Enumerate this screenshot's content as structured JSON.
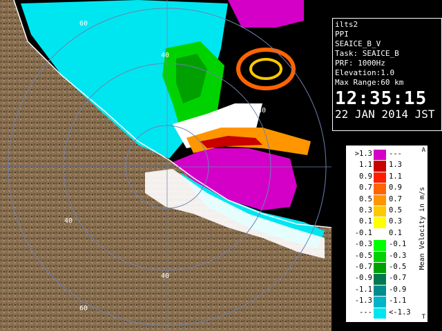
{
  "info": {
    "radar": "ilts2",
    "product": "PPI",
    "field": "SEAICE_B_V",
    "task": "Task: SEAICE_B",
    "prf": "PRF: 1000Hz",
    "elevation": "Elevation:1.0",
    "max_range": "Max Range:60 km",
    "time": "12:35:15",
    "date": "22 JAN 2014 JST"
  },
  "legend": {
    "title": "Mean Velocity in m/s",
    "corner_top": "A",
    "corner_bottom": "T",
    "rows": [
      {
        "left": ">1.3",
        "right": "---",
        "color": "#d400c8"
      },
      {
        "left": "1.1",
        "right": "1.3",
        "color": "#c80000"
      },
      {
        "left": "0.9",
        "right": "1.1",
        "color": "#ff1e00"
      },
      {
        "left": "0.7",
        "right": "0.9",
        "color": "#ff6400"
      },
      {
        "left": "0.5",
        "right": "0.7",
        "color": "#ff9600"
      },
      {
        "left": "0.3",
        "right": "0.5",
        "color": "#ffc800"
      },
      {
        "left": "0.1",
        "right": "0.3",
        "color": "#ffff00"
      },
      {
        "left": "-0.1",
        "right": "0.1",
        "color": "#ffffff"
      },
      {
        "left": "-0.3",
        "right": "-0.1",
        "color": "#00ff00"
      },
      {
        "left": "-0.5",
        "right": "-0.3",
        "color": "#00d200"
      },
      {
        "left": "-0.7",
        "right": "-0.5",
        "color": "#00a000"
      },
      {
        "left": "-0.9",
        "right": "-0.7",
        "color": "#007850"
      },
      {
        "left": "-1.1",
        "right": "-0.9",
        "color": "#008c8c"
      },
      {
        "left": "-1.3",
        "right": "-1.1",
        "color": "#00b4c8"
      },
      {
        "left": "---",
        "right": "<-1.3",
        "color": "#00e6f0"
      }
    ]
  },
  "map": {
    "range_labels": [
      "60",
      "40",
      "40",
      "40",
      "40",
      "60"
    ],
    "colors": {
      "sea": "#000000",
      "land": "#8a7050",
      "ring": "#6f7fb0",
      "coast": "#ffffff"
    }
  }
}
